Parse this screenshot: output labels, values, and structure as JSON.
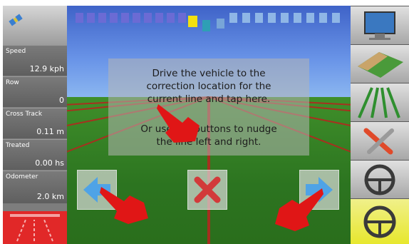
{
  "left_panel": {
    "metrics": [
      {
        "label": "Speed",
        "value": "12.9 kph"
      },
      {
        "label": "Row",
        "value": "0"
      },
      {
        "label": "Cross Track",
        "value": "0.11 m"
      },
      {
        "label": "Treated",
        "value": "0.00 hs"
      },
      {
        "label": "Odometer",
        "value": "2.0 km"
      }
    ]
  },
  "dialog": {
    "line1": "Drive the vehicle to the",
    "line2": "correction location for the",
    "line3": "current line and tap here.",
    "line4": "Or use the buttons to nudge",
    "line5": "the line left and right."
  },
  "colors": {
    "accent_red": "#e02020",
    "accent_yellow": "#e8e82a",
    "lightbar_dim": "#6a6ad2",
    "lightbar_on": "#f2e10f",
    "lightbar_center": "#2e9fb5"
  },
  "icons": {
    "top_left": "satellite-icon",
    "bottom_left": "lane-guidance-icon",
    "right": [
      "screen-touch-icon",
      "field-map-icon",
      "guidance-lines-icon",
      "tools-icon",
      "steering-wheel-icon",
      "steering-wheel-active-icon"
    ]
  }
}
